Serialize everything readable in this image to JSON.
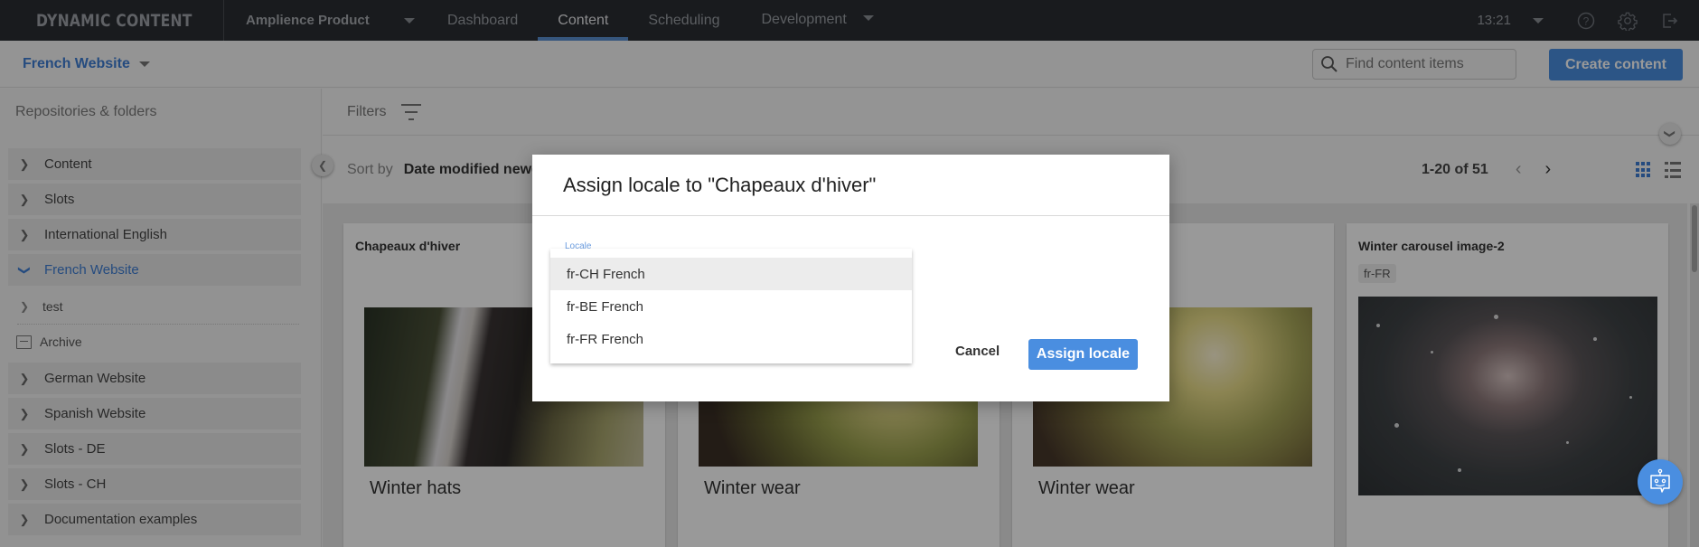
{
  "app": {
    "brand": "DYNAMIC CONTENT",
    "hub": "Amplience Product",
    "nav_tabs": [
      {
        "label": "Dashboard",
        "active": false
      },
      {
        "label": "Content",
        "active": true
      },
      {
        "label": "Scheduling",
        "active": false
      },
      {
        "label": "Development",
        "active": false
      }
    ],
    "clock": "13:21",
    "icons": [
      "help-icon",
      "settings-icon",
      "logout-icon"
    ]
  },
  "subheader": {
    "repository": "French Website",
    "search_placeholder": "Find content items",
    "create_label": "Create content"
  },
  "sidebar": {
    "title": "Repositories & folders",
    "items_top": [
      {
        "label": "Content",
        "expanded": false
      },
      {
        "label": "Slots",
        "expanded": false
      },
      {
        "label": "International English",
        "expanded": false
      },
      {
        "label": "French Website",
        "expanded": true
      }
    ],
    "sub_items": [
      {
        "label": "test"
      }
    ],
    "archive_label": "Archive",
    "items_bottom": [
      {
        "label": "German Website"
      },
      {
        "label": "Spanish Website"
      },
      {
        "label": "Slots - DE"
      },
      {
        "label": "Slots - CH"
      },
      {
        "label": "Documentation examples"
      }
    ]
  },
  "main": {
    "filters_label": "Filters",
    "sort_label": "Sort by",
    "sort_value": "Date modified newest",
    "page_count": "1-20 of 51",
    "cards": [
      {
        "title": "Chapeaux d'hiver",
        "badge": "",
        "caption": "Winter hats"
      },
      {
        "title": "",
        "badge": "",
        "caption": "Winter wear"
      },
      {
        "title": "",
        "badge": "",
        "caption": "Winter wear"
      },
      {
        "title": "Winter carousel image-2",
        "badge": "fr-FR",
        "caption": ""
      }
    ]
  },
  "dialog": {
    "title": "Assign locale to \"Chapeaux d'hiver\"",
    "field_label": "Locale",
    "options": [
      {
        "label": "fr-CH French",
        "highlighted": true
      },
      {
        "label": "fr-BE French",
        "highlighted": false
      },
      {
        "label": "fr-FR French",
        "highlighted": false
      }
    ],
    "cancel_label": "Cancel",
    "assign_label": "Assign locale"
  },
  "colors": {
    "accent": "#4a8ee0",
    "link": "#3e7ed4",
    "topbar": "#2a2d33"
  }
}
